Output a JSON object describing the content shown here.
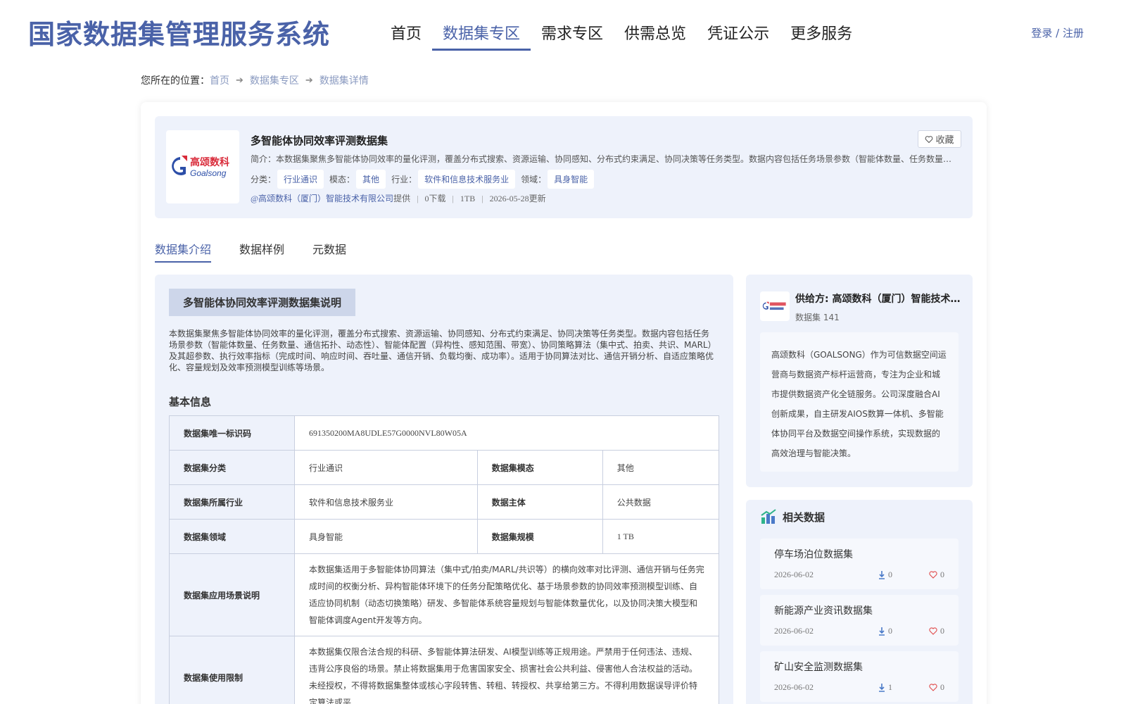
{
  "header": {
    "title": "国家数据集管理服务系统",
    "nav": [
      "首页",
      "数据集专区",
      "需求专区",
      "供需总览",
      "凭证公示",
      "更多服务"
    ],
    "active_nav": 1,
    "login": "登录 / 注册"
  },
  "breadcrumb": {
    "prefix": "您所在的位置：",
    "items": [
      "首页",
      "数据集专区",
      "数据集详情"
    ]
  },
  "dataset": {
    "title": "多智能体协同效率评测数据集",
    "fav_label": "收藏",
    "intro": "简介：本数据集聚焦多智能体协同效率的量化评测，覆盖分布式搜索、资源运输、协同感知、分布式约束满足、协同决策等任务类型。数据内容包括任务场景参数（智能体数量、任务数量、通信拓扑、动态性）、智能体配置（异构性、感知范围、带宽）、协同策略算法（集中式、拍卖、共识、MARL）及其超参数、执行效率指标（完成时间、响应时间、吞吐量、通信开销、负载均衡、成功率）。",
    "category_label": "分类：",
    "category": "行业通识",
    "modality_label": "模态：",
    "modality": "其他",
    "industry_label": "行业：",
    "industry": "软件和信息技术服务业",
    "domain_label": "领域：",
    "domain": "具身智能",
    "provider": "@高颂数科（厦门）智能技术有限公司",
    "provider_suffix": "提供",
    "downloads": "0下载",
    "size": "1TB",
    "updated": "2026-05-28更新"
  },
  "logo_text": {
    "cn": "高颂数科",
    "en": "Goalsong",
    "brand_color": "#d92b3a",
    "text_color": "#2d4fa8"
  },
  "tabs": [
    "数据集介绍",
    "数据样例",
    "元数据"
  ],
  "description": {
    "title": "多智能体协同效率评测数据集说明",
    "text": "本数据集聚焦多智能体协同效率的量化评测，覆盖分布式搜索、资源运输、协同感知、分布式约束满足、协同决策等任务类型。数据内容包括任务场景参数（智能体数量、任务数量、通信拓扑、动态性）、智能体配置（异构性、感知范围、带宽）、协同策略算法（集中式、拍卖、共识、MARL）及其超参数、执行效率指标（完成时间、响应时间、吞吐量、通信开销、负载均衡、成功率）。适用于协同算法对比、通信开销分析、自适应策略优化、容量规划及效率预测模型训练等场景。"
  },
  "basic_info": {
    "title": "基本信息",
    "uid_label": "数据集唯一标识码",
    "uid": "691350200MA8UDLE57G0000NVL80W05A",
    "category_label": "数据集分类",
    "category": "行业通识",
    "modality_label": "数据集模态",
    "modality": "其他",
    "industry_label": "数据集所属行业",
    "industry": "软件和信息技术服务业",
    "subject_label": "数据主体",
    "subject": "公共数据",
    "domain_label": "数据集领域",
    "domain": "具身智能",
    "scale_label": "数据集规模",
    "scale": "1 TB",
    "scenario_label": "数据集应用场景说明",
    "scenario": "本数据集适用于多智能体协同算法（集中式/拍卖/MARL/共识等）的横向效率对比评测、通信开销与任务完成时间的权衡分析、异构智能体环境下的任务分配策略优化、基于场景参数的协同效率预测模型训练、自适应协同机制（动态切换策略）研发、多智能体系统容量规划与智能体数量优化，以及协同决策大模型和智能体调度Agent开发等方向。",
    "limit_label": "数据集使用限制",
    "limit": "本数据集仅限合法合规的科研、多智能体算法研发、AI模型训练等正规用途。严禁用于任何违法、违规、违背公序良俗的场景。禁止将数据集用于危害国家安全、损害社会公共利益、侵害他人合法权益的活动。未经授权，不得将数据集整体或核心字段转售、转租、转授权、共享给第三方。不得利用数据误导评价特定算法或平"
  },
  "provider_card": {
    "name": "供给方: 高颂数科（厦门）智能技术有限公司",
    "count": "数据集 141",
    "desc": "高颂数科（GOALSONG）作为可信数据空间运营商与数据资产标杆运营商，专注为企业和城市提供数据资产化全链服务。公司深度融合AI创新成果，自主研发AIOS数算一体机、多智能体协同平台及数据空间操作系统，实现数据的高效治理与智能决策。"
  },
  "related": {
    "title": "相关数据",
    "items": [
      {
        "name": "停车场泊位数据集",
        "date": "2026-06-02",
        "downloads": "0",
        "likes": "0"
      },
      {
        "name": "新能源产业资讯数据集",
        "date": "2026-06-02",
        "downloads": "0",
        "likes": "0"
      },
      {
        "name": "矿山安全监测数据集",
        "date": "2026-06-02",
        "downloads": "1",
        "likes": "0"
      }
    ]
  },
  "colors": {
    "accent": "#4a62a8",
    "panel_bg": "#eef2fb",
    "like_red": "#e04a4a",
    "download_blue": "#4a7ac8"
  }
}
